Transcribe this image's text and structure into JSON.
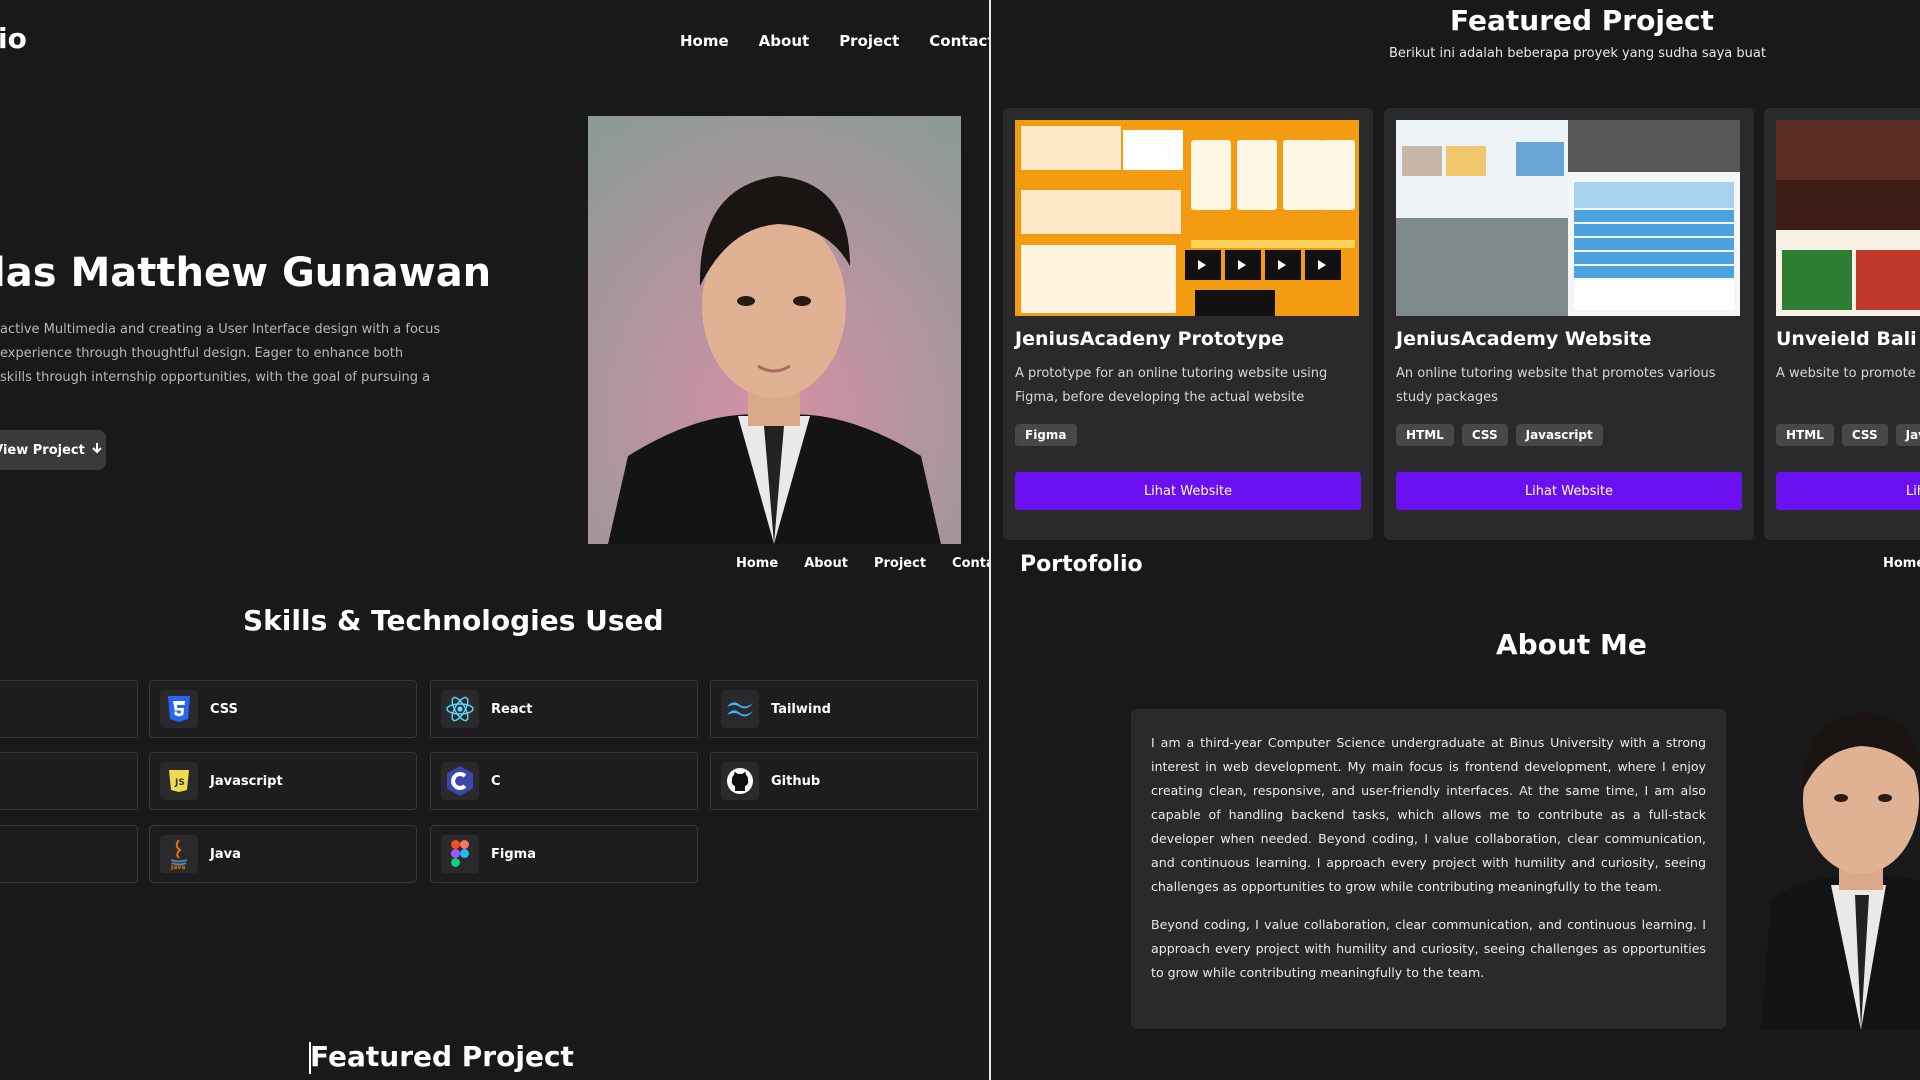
{
  "left": {
    "brand": "io",
    "nav": [
      "Home",
      "About",
      "Project",
      "Contact"
    ],
    "hero": {
      "name": "las Matthew Gunawan",
      "description_lines": [
        "active Multimedia and creating a User Interface design with a focus",
        "experience through thoughtful design. Eager to enhance both",
        "skills through internship opportunities, with the goal of pursuing a"
      ],
      "cta": "View Project"
    },
    "nav_secondary": [
      "Home",
      "About",
      "Project",
      "Contact"
    ],
    "skills_title": "Skills & Technologies Used",
    "skills": [
      {
        "name": "CSS",
        "icon": "css3-icon"
      },
      {
        "name": "React",
        "icon": "react-icon"
      },
      {
        "name": "Tailwind",
        "icon": "tailwind-icon"
      },
      {
        "name": "Javascript",
        "icon": "javascript-icon"
      },
      {
        "name": "C",
        "icon": "c-language-icon"
      },
      {
        "name": "Github",
        "icon": "github-icon"
      },
      {
        "name": "Java",
        "icon": "java-icon"
      },
      {
        "name": "Figma",
        "icon": "figma-icon"
      }
    ],
    "featured_title": "Featured Project"
  },
  "right": {
    "featured_title": "Featured Project",
    "featured_subtitle": "Berikut ini adalah beberapa proyek yang sudha saya buat",
    "projects": [
      {
        "title": "JeniusAcadeny Prototype",
        "description": "A prototype for an online tutoring website using Figma, before developing the actual website",
        "tags": [
          "Figma"
        ],
        "button": "Lihat Website"
      },
      {
        "title": "JeniusAcademy Website",
        "description": "An online tutoring website that promotes various study packages",
        "tags": [
          "HTML",
          "CSS",
          "Javascript"
        ],
        "button": "Lihat Website"
      },
      {
        "title": "Unveield Bali We",
        "description": "A website to promote Ba culture, destinations, foo",
        "tags": [
          "HTML",
          "CSS",
          "Java"
        ],
        "button": "Lih"
      }
    ],
    "brand": "Portofolio",
    "nav": [
      "Home"
    ],
    "about_title": "About Me",
    "about_paragraphs": [
      "I am a third-year Computer Science undergraduate at Binus University with a strong interest in web development. My main focus is frontend development, where I enjoy creating clean, responsive, and user-friendly interfaces. At the same time, I am also capable of handling backend tasks, which allows me to contribute as a full-stack developer when needed. Beyond coding, I value collaboration, clear communication, and continuous learning. I approach every project with humility and curiosity, seeing challenges as opportunities to grow while contributing meaningfully to the team.",
      "Beyond coding, I value collaboration, clear communication, and continuous learning. I approach every project with humility and curiosity, seeing challenges as opportunities to grow while contributing meaningfully to the team."
    ]
  },
  "colors": {
    "background": "#19191b",
    "card": "#2a2a2d",
    "accent": "#6a0ff0",
    "tag": "#48484b"
  }
}
